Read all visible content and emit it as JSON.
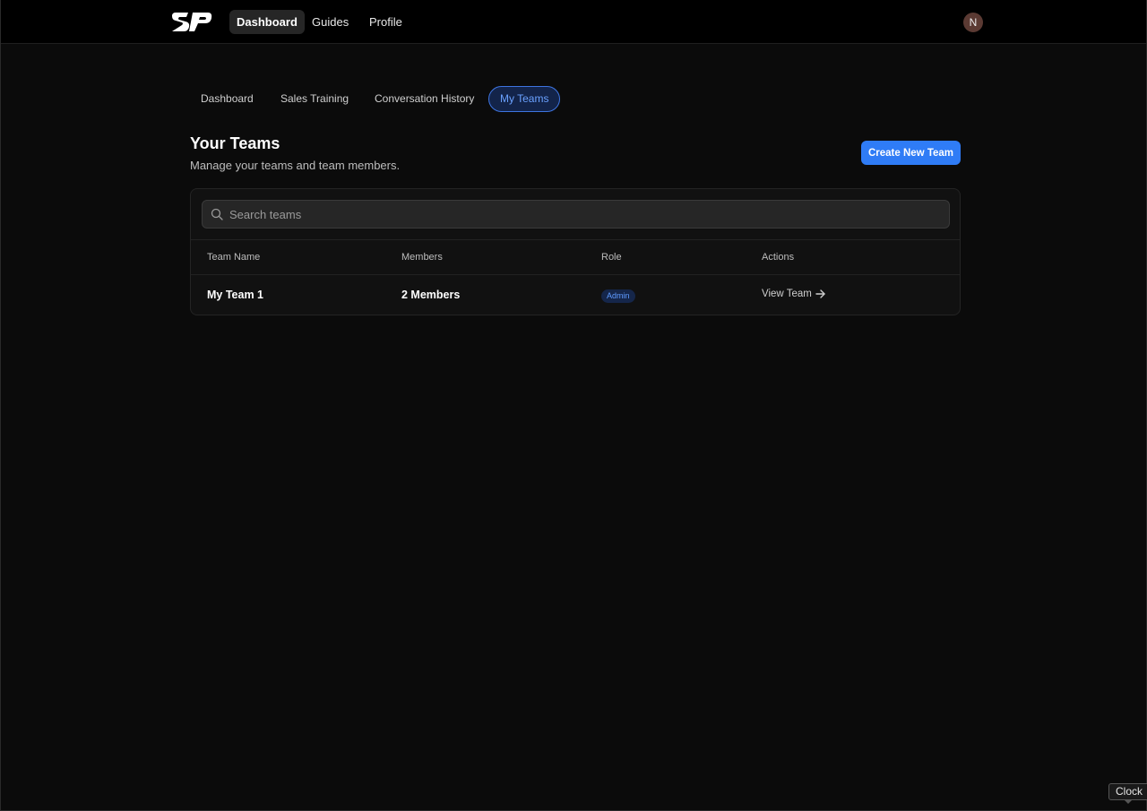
{
  "topnav": {
    "logo_icon": "sp-logo-icon",
    "items": [
      {
        "label": "Dashboard",
        "active": true
      },
      {
        "label": "Guides",
        "active": false
      },
      {
        "label": "Profile",
        "active": false
      }
    ],
    "avatar_initial": "N"
  },
  "subtabs": [
    {
      "label": "Dashboard",
      "active": false
    },
    {
      "label": "Sales Training",
      "active": false
    },
    {
      "label": "Conversation History",
      "active": false
    },
    {
      "label": "My Teams",
      "active": true
    }
  ],
  "page": {
    "title": "Your Teams",
    "subtitle": "Manage your teams and team members.",
    "create_button": "Create New Team"
  },
  "search": {
    "placeholder": "Search teams",
    "value": "",
    "icon": "search-icon"
  },
  "table": {
    "columns": [
      "Team Name",
      "Members",
      "Role",
      "Actions"
    ],
    "rows": [
      {
        "team_name": "My Team 1",
        "members": "2 Members",
        "role": "Admin",
        "action": "View Team"
      }
    ]
  },
  "tooltip": "Clock",
  "colors": {
    "accent": "#2f7cf6",
    "badge_bg": "#15264a",
    "badge_text": "#5f9bff",
    "background": "#0b0b0b"
  }
}
